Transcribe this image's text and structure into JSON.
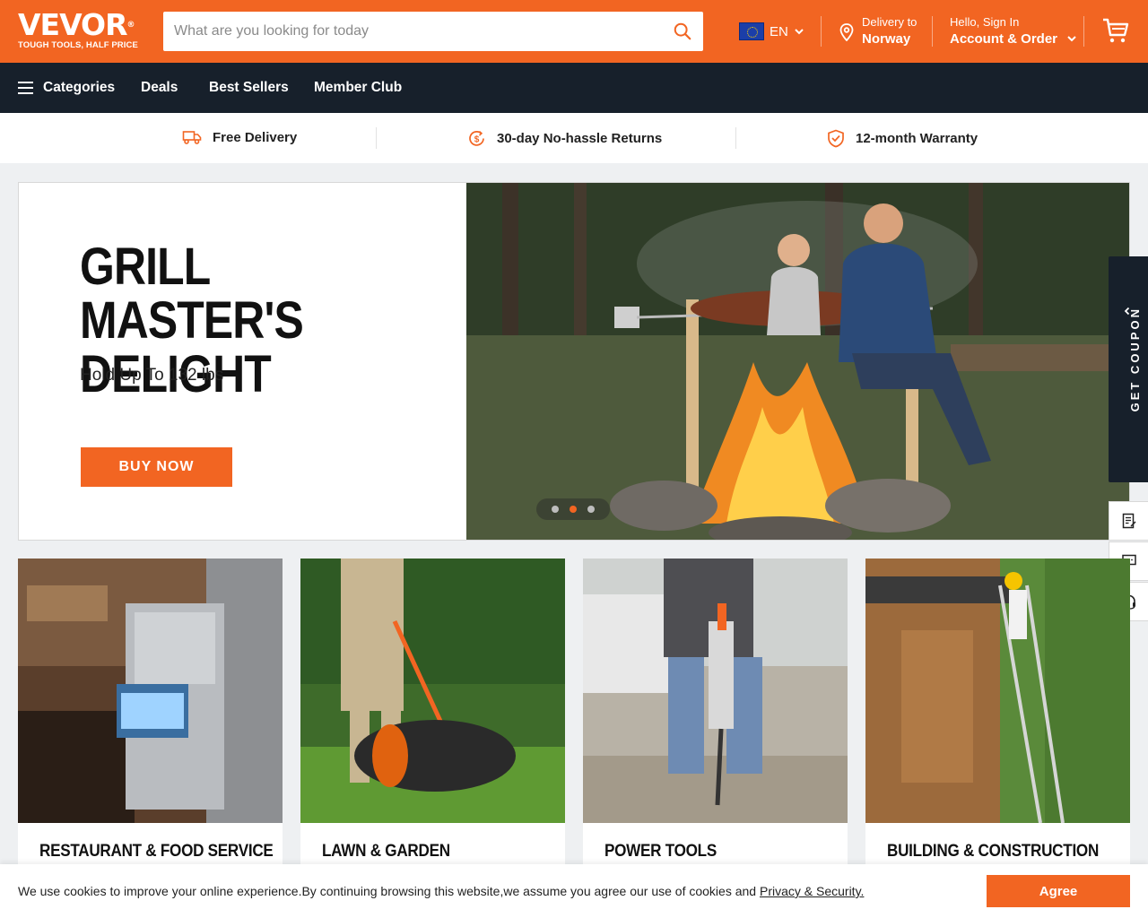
{
  "header": {
    "brand": "VEVOR",
    "brand_mark": "®",
    "tagline": "TOUGH TOOLS, HALF PRICE",
    "search_placeholder": "What are you looking for today",
    "language": "EN",
    "delivery_label": "Delivery to",
    "delivery_country": "Norway",
    "greeting": "Hello, Sign In",
    "account_label": "Account & Order"
  },
  "nav": {
    "categories": "Categories",
    "deals": "Deals",
    "best_sellers": "Best Sellers",
    "member_club": "Member Club"
  },
  "trust": {
    "delivery": "Free Delivery",
    "returns": "30-day No-hassle Returns",
    "warranty": "12-month Warranty"
  },
  "hero": {
    "title": "GRILL MASTER'S DELIGHT",
    "subtitle": "Hold Up To 132 lbs",
    "cta": "BUY NOW",
    "slide_count": 3,
    "active_slide": 2
  },
  "sidebar": {
    "coupon": "GET COUPON"
  },
  "categories": [
    {
      "title": "RESTAURANT & FOOD SERVICE"
    },
    {
      "title": "LAWN & GARDEN"
    },
    {
      "title": "POWER TOOLS"
    },
    {
      "title": "BUILDING & CONSTRUCTION"
    }
  ],
  "cookie": {
    "message": "We use cookies to improve your online experience.By continuing browsing this website,we assume you agree our use of cookies and ",
    "link": "Privacy & Security.",
    "agree": "Agree"
  },
  "colors": {
    "brand_orange": "#f26522",
    "nav_dark": "#17202b"
  }
}
